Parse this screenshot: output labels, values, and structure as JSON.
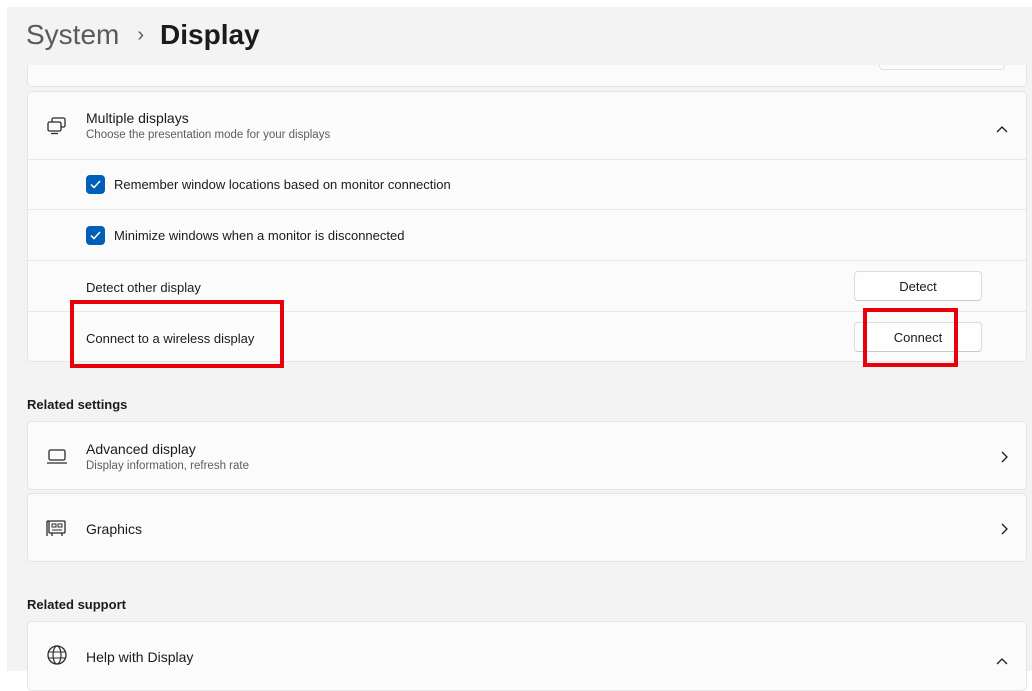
{
  "breadcrumb": {
    "parent": "System",
    "separator": "›",
    "current": "Display"
  },
  "multiple_displays": {
    "title": "Multiple displays",
    "subtitle": "Choose the presentation mode for your displays",
    "icon": "multiple-displays-icon",
    "expanded": true,
    "options": [
      {
        "label": "Remember window locations based on monitor connection",
        "checked": true
      },
      {
        "label": "Minimize windows when a monitor is disconnected",
        "checked": true
      }
    ],
    "detect": {
      "label": "Detect other display",
      "button": "Detect"
    },
    "connect": {
      "label": "Connect to a wireless display",
      "button": "Connect"
    }
  },
  "related_settings": {
    "heading": "Related settings",
    "items": [
      {
        "title": "Advanced display",
        "subtitle": "Display information, refresh rate",
        "icon": "monitor-icon"
      },
      {
        "title": "Graphics",
        "icon": "graphics-card-icon"
      }
    ]
  },
  "related_support": {
    "heading": "Related support",
    "items": [
      {
        "title": "Help with Display",
        "icon": "globe-icon",
        "expanded": true
      }
    ]
  },
  "colors": {
    "accent": "#005fb8",
    "highlight": "#e8000b",
    "background": "#f3f3f3",
    "card": "#fbfbfb"
  }
}
